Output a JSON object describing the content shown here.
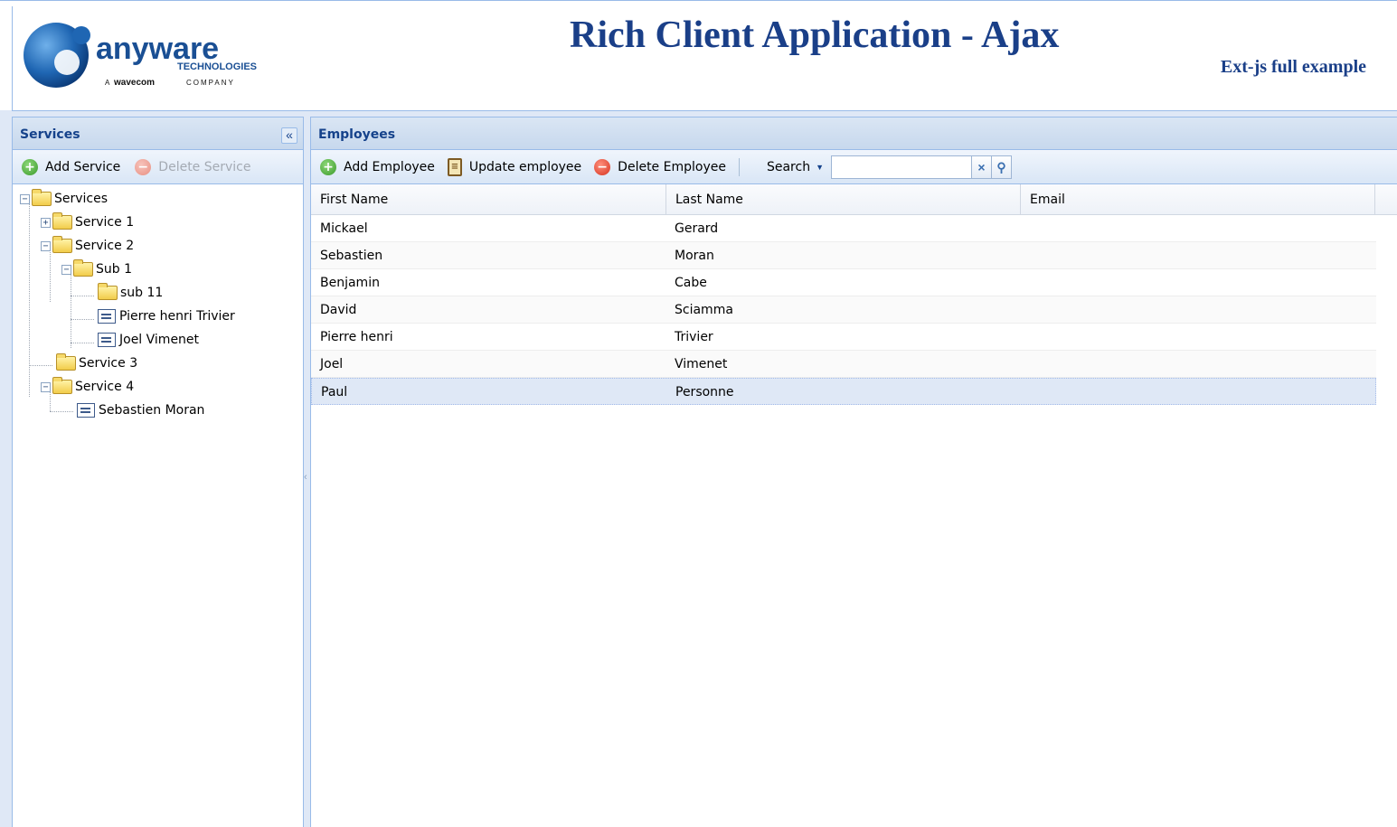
{
  "header": {
    "logo": {
      "brand": "anyware",
      "sub": "TECHNOLOGIES",
      "tagline_prefix": "A",
      "tagline_brand": "wavecom",
      "tagline_suffix": "COMPANY"
    },
    "title": "Rich Client Application - Ajax",
    "subtitle": "Ext-js full example"
  },
  "services": {
    "title": "Services",
    "collapse_icon": "«",
    "toolbar": {
      "add_label": "Add Service",
      "delete_label": "Delete Service"
    },
    "tree": {
      "root": "Services",
      "service1": "Service 1",
      "service2": "Service 2",
      "sub1": "Sub 1",
      "sub11": "sub 11",
      "pierre": "Pierre henri Trivier",
      "joel": "Joel Vimenet",
      "service3": "Service 3",
      "service4": "Service 4",
      "sebastien": "Sebastien Moran"
    }
  },
  "employees": {
    "title": "Employees",
    "toolbar": {
      "add_label": "Add Employee",
      "update_label": "Update employee",
      "delete_label": "Delete Employee",
      "search_label": "Search",
      "search_value": "",
      "clear_icon": "×",
      "search_icon": "⚲"
    },
    "columns": [
      "First Name",
      "Last Name",
      "Email"
    ],
    "rows": [
      {
        "first": "Mickael",
        "last": "Gerard",
        "email": ""
      },
      {
        "first": "Sebastien",
        "last": "Moran",
        "email": ""
      },
      {
        "first": "Benjamin",
        "last": "Cabe",
        "email": ""
      },
      {
        "first": "David",
        "last": "Sciamma",
        "email": ""
      },
      {
        "first": "Pierre henri",
        "last": "Trivier",
        "email": ""
      },
      {
        "first": "Joel",
        "last": "Vimenet",
        "email": ""
      },
      {
        "first": "Paul",
        "last": "Personne",
        "email": ""
      }
    ],
    "selected_row": 6
  },
  "colors": {
    "title": "#1a3f88",
    "panel_header_text": "#15428b",
    "border": "#99bbe8",
    "selected_row": "#dfe8f6"
  }
}
